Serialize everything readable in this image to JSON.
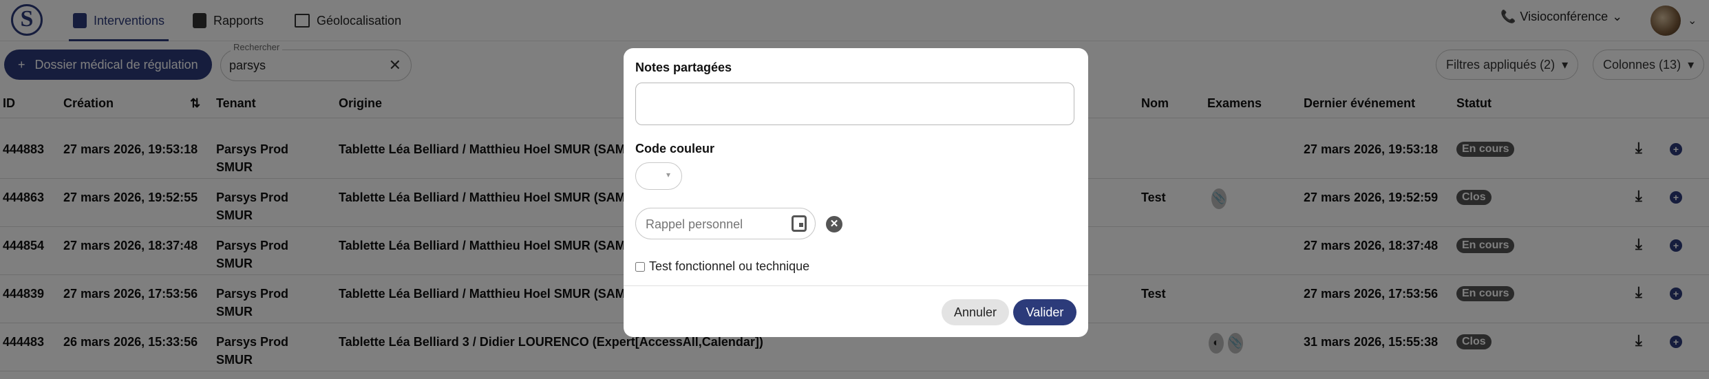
{
  "nav": {
    "tabs": [
      {
        "label": "Interventions",
        "icon": "clipboard-icon",
        "active": true
      },
      {
        "label": "Rapports",
        "icon": "document-icon",
        "active": false
      },
      {
        "label": "Géolocalisation",
        "icon": "map-icon",
        "active": false
      }
    ],
    "visio_label": "Visioconférence"
  },
  "toolbar": {
    "new_record_label": "Dossier médical de régulation",
    "search_label": "Rechercher",
    "search_value": "parsys",
    "filters_label": "Filtres appliqués (2)",
    "columns_label": "Colonnes (13)"
  },
  "table": {
    "headers": {
      "id": "ID",
      "creation": "Création",
      "tenant": "Tenant",
      "origine": "Origine",
      "nom": "Nom",
      "examens": "Examens",
      "dernier": "Dernier événement",
      "statut": "Statut"
    },
    "rows": [
      {
        "id": "444883",
        "creation": "27 mars 2026, 19:53:18",
        "tenant_1": "Parsys Prod",
        "tenant_2": "SMUR",
        "origine": "Tablette Léa Belliard / Matthieu Hoel SMUR (SAM",
        "nom": "",
        "dernier": "27 mars 2026, 19:53:18",
        "statut": "En cours"
      },
      {
        "id": "444863",
        "creation": "27 mars 2026, 19:52:55",
        "tenant_1": "Parsys Prod",
        "tenant_2": "SMUR",
        "origine": "Tablette Léa Belliard / Matthieu Hoel SMUR (SAM",
        "nom": "Test",
        "dernier": "27 mars 2026, 19:52:59",
        "statut": "Clos"
      },
      {
        "id": "444854",
        "creation": "27 mars 2026, 18:37:48",
        "tenant_1": "Parsys Prod",
        "tenant_2": "SMUR",
        "origine": "Tablette Léa Belliard / Matthieu Hoel SMUR (SAM",
        "nom": "",
        "dernier": "27 mars 2026, 18:37:48",
        "statut": "En cours"
      },
      {
        "id": "444839",
        "creation": "27 mars 2026, 17:53:56",
        "tenant_1": "Parsys Prod",
        "tenant_2": "SMUR",
        "origine": "Tablette Léa Belliard / Matthieu Hoel SMUR (SAM",
        "nom": "Test",
        "dernier": "27 mars 2026, 17:53:56",
        "statut": "En cours"
      },
      {
        "id": "444483",
        "creation": "26 mars 2026, 15:33:56",
        "tenant_1": "Parsys Prod",
        "tenant_2": "SMUR",
        "origine": "Tablette Léa Belliard 3 / Didier LOURENCO (Expert[AccessAll,Calendar])",
        "nom": "",
        "dernier": "31 mars 2026, 15:55:38",
        "statut": "Clos"
      }
    ]
  },
  "modal": {
    "notes_label": "Notes partagées",
    "notes_value": "",
    "color_label": "Code couleur",
    "reminder_placeholder": "Rappel personnel",
    "checkbox_label": "Test fonctionnel ou technique",
    "cancel_label": "Annuler",
    "ok_label": "Valider"
  },
  "colors": {
    "primary": "#2c3b7a",
    "badge": "#555555",
    "overlay": "rgba(0,0,0,0.5)"
  }
}
